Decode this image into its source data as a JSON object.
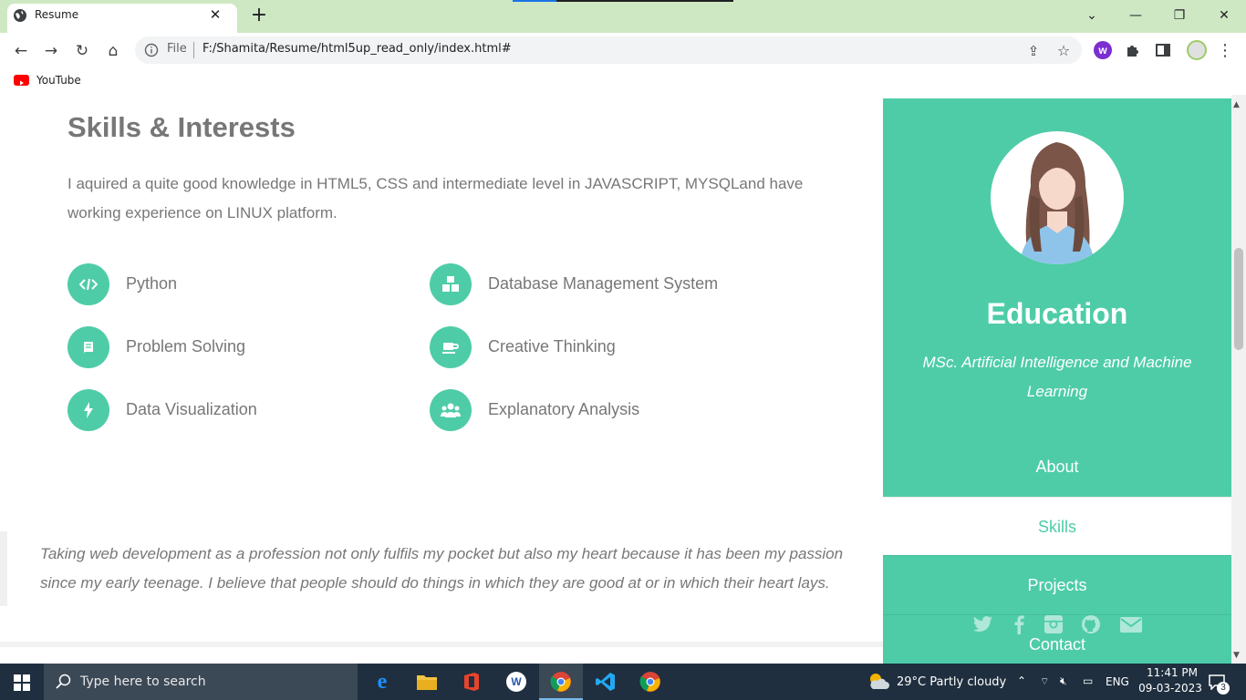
{
  "browser": {
    "tab_title": "Resume",
    "new_tab": "+",
    "address": {
      "scheme_label": "File",
      "url": "F:/Shamita/Resume/html5up_read_only/index.html#"
    },
    "bookmarks": [
      {
        "label": "YouTube",
        "icon": "youtube-icon"
      }
    ]
  },
  "skills": {
    "title": "Skills & Interests",
    "description": "I aquired a quite good knowledge in HTML5, CSS and intermediate level in JAVASCRIPT, MYSQLand have working experience on LINUX platform.",
    "items": [
      {
        "label": "Python",
        "icon": "code-icon"
      },
      {
        "label": "Database Management System",
        "icon": "cubes-icon"
      },
      {
        "label": "Problem Solving",
        "icon": "book-icon"
      },
      {
        "label": "Creative Thinking",
        "icon": "coffee-icon"
      },
      {
        "label": "Data Visualization",
        "icon": "bolt-icon"
      },
      {
        "label": "Explanatory Analysis",
        "icon": "users-icon"
      }
    ]
  },
  "quote": "Taking web development as a profession not only fulfils my pocket but also my heart because it has been my passion since my early teenage. I believe that people should do things in which they are good at or in which their heart lays.",
  "sidebar": {
    "title": "Education",
    "subtitle": "MSc. Artificial Intelligence and Machine Learning",
    "nav": [
      {
        "label": "About",
        "active": false
      },
      {
        "label": "Skills",
        "active": true
      },
      {
        "label": "Projects",
        "active": false
      },
      {
        "label": "Contact",
        "active": false
      }
    ],
    "social": [
      "twitter-icon",
      "facebook-icon",
      "instagram-icon",
      "github-icon",
      "envelope-icon"
    ]
  },
  "taskbar": {
    "search_placeholder": "Type here to search",
    "weather": "29°C  Partly cloudy",
    "language": "ENG",
    "time": "11:41 PM",
    "date": "09-03-2023",
    "notifications": "3"
  },
  "colors": {
    "accent": "#4ecca8",
    "titlebar": "#cfe8c4",
    "taskbar": "#1f2f3f"
  }
}
